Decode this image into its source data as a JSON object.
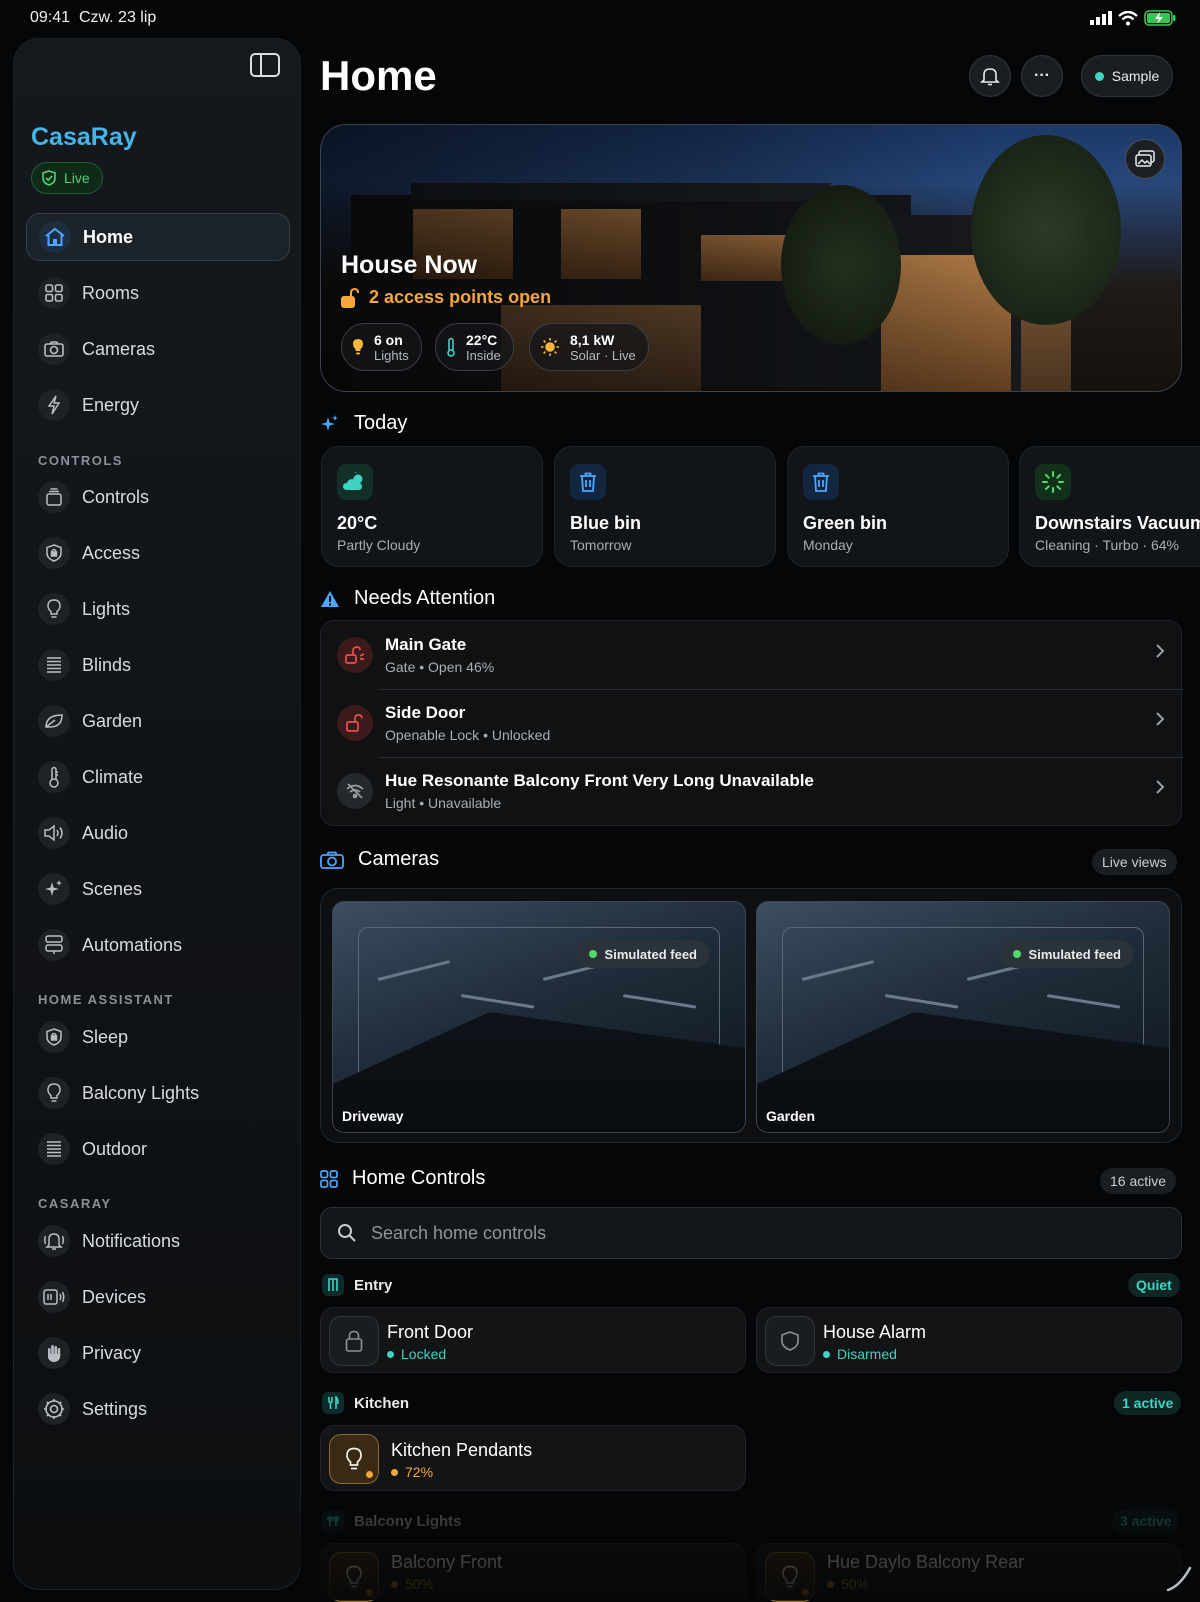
{
  "status_bar": {
    "time": "09:41",
    "date": "Czw. 23 lip"
  },
  "sidebar": {
    "brand": "CasaRay",
    "live_label": "Live",
    "primary_items": [
      {
        "label": "Home",
        "icon": "home-icon",
        "active": true
      },
      {
        "label": "Rooms",
        "icon": "grid-icon"
      },
      {
        "label": "Cameras",
        "icon": "camera-icon"
      },
      {
        "label": "Energy",
        "icon": "bolt-icon"
      }
    ],
    "sections": [
      {
        "title": "CONTROLS",
        "items": [
          {
            "label": "Controls",
            "icon": "stack-icon"
          },
          {
            "label": "Access",
            "icon": "shield-lock-icon"
          },
          {
            "label": "Lights",
            "icon": "bulb-icon"
          },
          {
            "label": "Blinds",
            "icon": "blinds-icon"
          },
          {
            "label": "Garden",
            "icon": "leaf-icon"
          },
          {
            "label": "Climate",
            "icon": "thermometer-icon"
          },
          {
            "label": "Audio",
            "icon": "speaker-icon"
          },
          {
            "label": "Scenes",
            "icon": "sparkles-icon"
          },
          {
            "label": "Automations",
            "icon": "automation-icon"
          }
        ]
      },
      {
        "title": "HOME ASSISTANT",
        "items": [
          {
            "label": "Sleep",
            "icon": "shield-lock-icon"
          },
          {
            "label": "Balcony Lights",
            "icon": "bulb-icon"
          },
          {
            "label": "Outdoor",
            "icon": "blinds-icon"
          }
        ]
      },
      {
        "title": "CASARAY",
        "items": [
          {
            "label": "Notifications",
            "icon": "bell-ring-icon"
          },
          {
            "label": "Devices",
            "icon": "devices-icon"
          },
          {
            "label": "Privacy",
            "icon": "hand-icon"
          },
          {
            "label": "Settings",
            "icon": "gear-icon"
          }
        ]
      }
    ]
  },
  "header": {
    "title": "Home",
    "sample_label": "Sample",
    "more_label": "···"
  },
  "hero": {
    "title": "House Now",
    "alert": "2 access points open",
    "chips": [
      {
        "value": "6 on",
        "sub": "Lights",
        "icon": "bulb-icon"
      },
      {
        "value": "22°C",
        "sub": "Inside",
        "icon": "thermometer-icon"
      },
      {
        "value": "8,1 kW",
        "sub": "Solar · Live",
        "icon": "sun-icon"
      }
    ]
  },
  "today": {
    "title": "Today",
    "cards": [
      {
        "title": "20°C",
        "sub": "Partly Cloudy",
        "icon": "partly-cloudy-icon"
      },
      {
        "title": "Blue bin",
        "sub": "Tomorrow",
        "icon": "trash-icon"
      },
      {
        "title": "Green bin",
        "sub": "Monday",
        "icon": "trash-icon"
      },
      {
        "title": "Downstairs Vacuum",
        "sub": "Cleaning · Turbo · 64%",
        "icon": "spinner-icon"
      }
    ]
  },
  "attention": {
    "title": "Needs Attention",
    "rows": [
      {
        "title": "Main Gate",
        "sub": "Gate • Open 46%",
        "icon": "gate-open-icon"
      },
      {
        "title": "Side Door",
        "sub": "Openable Lock • Unlocked",
        "icon": "unlock-icon"
      },
      {
        "title": "Hue Resonante Balcony Front Very Long Unavailable",
        "sub": "Light • Unavailable",
        "icon": "wifi-off-icon"
      }
    ]
  },
  "cameras": {
    "title": "Cameras",
    "badge": "Live views",
    "feeds": [
      {
        "name": "Driveway",
        "feed": "Simulated feed"
      },
      {
        "name": "Garden",
        "feed": "Simulated feed"
      }
    ]
  },
  "home_controls": {
    "title": "Home Controls",
    "badge": "16 active",
    "search_placeholder": "Search home controls",
    "groups": [
      {
        "name": "Entry",
        "badge": "Quiet",
        "items": [
          {
            "name": "Front Door",
            "state": "Locked",
            "icon": "lock-icon"
          },
          {
            "name": "House Alarm",
            "state": "Disarmed",
            "icon": "shield-icon"
          }
        ]
      },
      {
        "name": "Kitchen",
        "badge": "1 active",
        "items": [
          {
            "name": "Kitchen Pendants",
            "state": "72%",
            "icon": "bulb-icon"
          }
        ]
      },
      {
        "name": "Balcony Lights",
        "badge": "3 active",
        "items": [
          {
            "name": "Balcony Front",
            "state": "50%",
            "icon": "bulb-icon"
          },
          {
            "name": "Hue Daylo Balcony Rear",
            "state": "50%",
            "icon": "bulb-icon"
          }
        ]
      }
    ]
  },
  "colors": {
    "accent": "#46b4e6",
    "live_green": "#4fd27a",
    "warning": "#f6a63a",
    "teal": "#3fd3c4",
    "danger": "#e5534b"
  }
}
